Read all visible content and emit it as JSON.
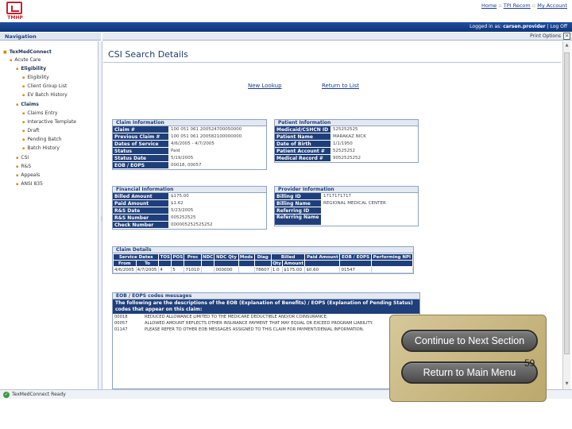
{
  "header": {
    "logo_text": "TMHP",
    "links": [
      "Home",
      "TPI Recom",
      "My Account"
    ],
    "logged_in_label": "Logged in as:",
    "logged_in_user": "carsen.provider",
    "logoff": "Log Off"
  },
  "nav": {
    "title": "Navigation",
    "print_options": "Print Options",
    "close_glyph": "×",
    "items": [
      {
        "label": "TexMedConnect",
        "level": 0
      },
      {
        "label": "Acute Care",
        "level": 1
      },
      {
        "label": "Eligibility",
        "level": 2
      },
      {
        "label": "Eligibility",
        "level": 3
      },
      {
        "label": "Client Group List",
        "level": 3
      },
      {
        "label": "EV Batch History",
        "level": 3
      },
      {
        "label": "Claims",
        "level": 2
      },
      {
        "label": "Claims Entry",
        "level": 3
      },
      {
        "label": "Interactive Template",
        "level": 3
      },
      {
        "label": "Draft",
        "level": 3
      },
      {
        "label": "Pending Batch",
        "level": 3
      },
      {
        "label": "Batch History",
        "level": 3
      },
      {
        "label": "CSI",
        "level": 2
      },
      {
        "label": "R&S",
        "level": 2
      },
      {
        "label": "Appeals",
        "level": 2
      },
      {
        "label": "ANSI 835",
        "level": 2
      }
    ]
  },
  "main": {
    "title": "CSI Search Details",
    "new_lookup": "New Lookup",
    "return_to_list": "Return to List",
    "claim_info": {
      "title": "Claim Information",
      "rows": [
        {
          "k": "Claim #",
          "v": "100 051 061 200524700050000"
        },
        {
          "k": "Previous Claim #",
          "v": "100 051 061 200582100000000"
        },
        {
          "k": "Dates of Service",
          "v": "4/6/2005 - 4/7/2005"
        },
        {
          "k": "Status",
          "v": "Paid"
        },
        {
          "k": "Status Date",
          "v": "5/19/2005"
        },
        {
          "k": "EOB / EOPS",
          "v": "00018, 00057"
        }
      ]
    },
    "patient_info": {
      "title": "Patient Information",
      "rows": [
        {
          "k": "Medicaid/CSHCN ID",
          "v": "525252525"
        },
        {
          "k": "Patient Name",
          "v": "MARAKAZ NICK"
        },
        {
          "k": "Date of Birth",
          "v": "1/1/1950"
        },
        {
          "k": "Patient Account #",
          "v": "52525252"
        },
        {
          "k": "Medical Record #",
          "v": "9052525252"
        }
      ]
    },
    "financial_info": {
      "title": "Financial Information",
      "rows": [
        {
          "k": "Billed Amount",
          "v": "$175.00"
        },
        {
          "k": "Paid Amount",
          "v": "$1.62"
        },
        {
          "k": "R&S Date",
          "v": "5/23/2005"
        },
        {
          "k": "R&S Number",
          "v": "005252525"
        },
        {
          "k": "Check Number",
          "v": "000005252525252"
        }
      ]
    },
    "provider_info": {
      "title": "Provider Information",
      "rows": [
        {
          "k": "Billing ID",
          "v": "1717171717"
        },
        {
          "k": "Billing Name",
          "v": "REGIONAL MEDICAL CENTER"
        },
        {
          "k": "Referring ID",
          "v": ""
        },
        {
          "k": "Referring Name",
          "v": ""
        }
      ]
    },
    "claim_details": {
      "title": "Claim Details",
      "headers": [
        "Service Dates",
        "TOS",
        "POS",
        "Proc",
        "NDC",
        "NDC Qty",
        "Mods",
        "Diag",
        "Billed",
        "Paid Amount",
        "EOB / EOPS",
        "Performing NPI"
      ],
      "subheaders": [
        "From",
        "To",
        "",
        "",
        "",
        "",
        "",
        "",
        "",
        "Qty",
        "Amount",
        "",
        "",
        ""
      ],
      "row": [
        "4/6/2005",
        "4/7/2005",
        "4",
        "5",
        "71010",
        "",
        "000000",
        "",
        "78607",
        "1.0",
        "$175.00",
        "$0.60",
        "01547",
        ""
      ]
    },
    "eob": {
      "title": "EOB / EOPS codes messages",
      "intro": "The following are the descriptions of the EOB (Explanation of Benefits) / EOPS (Explanation of Pending Status) codes that appear on this claim:",
      "rows": [
        {
          "code": "00018",
          "desc": "REDUCED ALLOWANCE LIMITED TO THE MEDICARE DEDUCTIBLE AND/OR COINSURANCE."
        },
        {
          "code": "00057",
          "desc": "ALLOWED AMOUNT REFLECTS OTHER INSURANCE PAYMENT THAT MAY EQUAL OR EXCEED PROGRAM LIABILITY."
        },
        {
          "code": "01147",
          "desc": "PLEASE REFER TO OTHER EOB MESSAGES ASSIGNED TO THIS CLAIM FOR PAYMENT/DENIAL INFORMATION."
        }
      ]
    }
  },
  "status_bar": {
    "text": "TexMedConnect Ready"
  },
  "overlay": {
    "continue": "Continue to Next Section",
    "return": "Return to Main Menu",
    "slide_number": "59"
  }
}
